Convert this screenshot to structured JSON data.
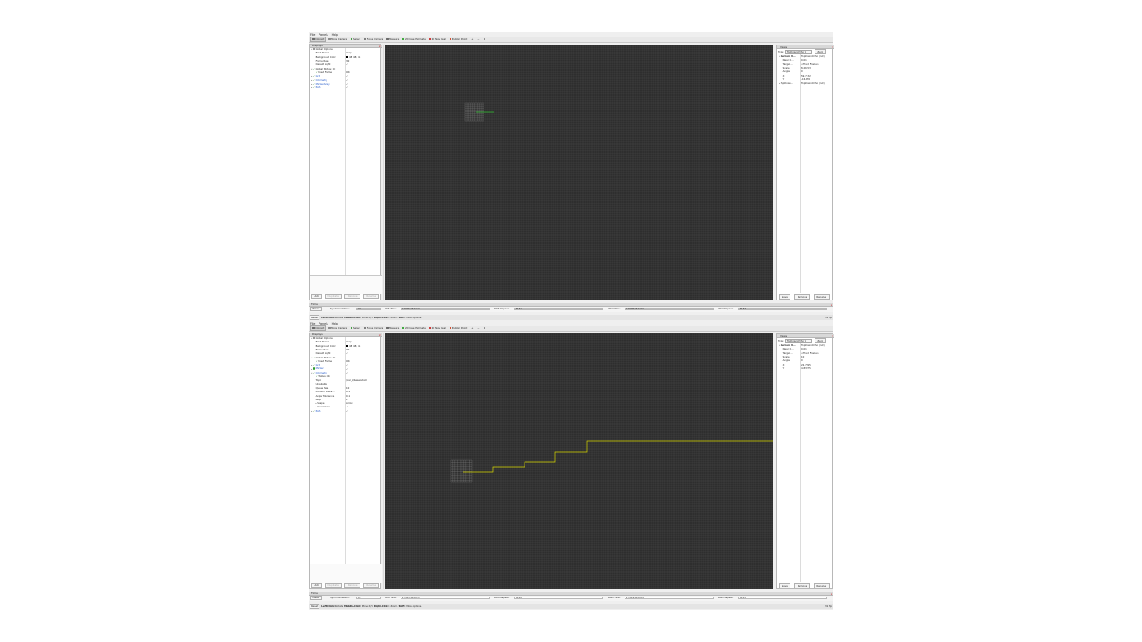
{
  "menu": [
    "File",
    "Panels",
    "Help"
  ],
  "toolbar": [
    {
      "label": "Interact",
      "icon": "interact-icon",
      "color": "#6a6a6a"
    },
    {
      "label": "Move Camera",
      "icon": "camera-icon",
      "color": "#8a8a8a"
    },
    {
      "label": "Select",
      "icon": "select-icon",
      "color": "#3f9b3f"
    },
    {
      "label": "Focus Camera",
      "icon": "focus-icon",
      "color": "#7a7a7a"
    },
    {
      "label": "Measure",
      "icon": "measure-icon",
      "color": "#6a6a6a"
    },
    {
      "label": "2D Pose Estimate",
      "icon": "pose-estimate-icon",
      "color": "#3aa83a"
    },
    {
      "label": "2D Nav Goal",
      "icon": "nav-goal-icon",
      "color": "#cc3333"
    },
    {
      "label": "Publish Point",
      "icon": "publish-point-icon",
      "color": "#d14a2a"
    }
  ],
  "toolbar_extras": [
    "+",
    "−",
    "↕"
  ],
  "displays_title": "Displays",
  "views_title": "Views",
  "time_title": "Time",
  "display_buttons": [
    "Add",
    "Duplicate",
    "Remove",
    "Rename"
  ],
  "view_type_label": "Type:",
  "view_type_value": "TopDownOrtho",
  "view_zero": "Zero",
  "view_buttons": [
    "Save",
    "Remove",
    "Rename"
  ],
  "time_labels": {
    "pause": "Pause",
    "sync": "Synchronization:",
    "ros_time": "ROS Time:",
    "ros_elapsed": "ROS Elapsed:",
    "wall_time": "Wall Time:",
    "wall_elapsed": "Wall Elapsed:"
  },
  "status": {
    "reset": "Reset",
    "hint_1": "Left-Click:",
    "hint_2": " Rotate. ",
    "hint_3": "Middle-Click:",
    "hint_4": " Move X/Y. ",
    "hint_5": "Right-Click:",
    "hint_6": ": Zoom. ",
    "hint_7": "Shift",
    "hint_8": ": More options."
  },
  "windows": [
    {
      "displays": [
        {
          "key": "Global Options",
          "value": "",
          "indent": 1,
          "expander": "▾",
          "icon": "gear-icon",
          "check": ""
        },
        {
          "key": "Fixed Frame",
          "value": "map",
          "indent": 3
        },
        {
          "key": "Background Color",
          "value": "48; 48; 48",
          "indent": 3,
          "swatch": true
        },
        {
          "key": "Frame Rate",
          "value": "30",
          "indent": 3
        },
        {
          "key": "Default Light",
          "value": "✓",
          "indent": 3
        },
        {
          "key": "Global Status: Ok",
          "value": "",
          "indent": 1,
          "expander": "▾",
          "check": "✓"
        },
        {
          "key": "Fixed Frame",
          "value": "OK",
          "indent": 3,
          "check": "✓"
        },
        {
          "key": "Grid",
          "value": "✓",
          "indent": 1,
          "expander": "▸",
          "check": "✓",
          "blue": true
        },
        {
          "key": "Odometry",
          "value": "✓",
          "indent": 1,
          "expander": "▸",
          "check": "✓",
          "blue": true
        },
        {
          "key": "MarkerArray",
          "value": "✓",
          "indent": 1,
          "expander": "▸",
          "check": "✓",
          "blue": true
        },
        {
          "key": "Path",
          "value": "✓",
          "indent": 1,
          "expander": "▸",
          "check": "✓",
          "blue": true
        }
      ],
      "views": [
        {
          "key": "Current V...",
          "value": "TopDownOrtho (rviz)",
          "indent": 1,
          "expander": "▾",
          "bold": true
        },
        {
          "key": "Near Cl...",
          "value": "0.01",
          "indent": 3
        },
        {
          "key": "Target ...",
          "value": "<Fixed Frame>",
          "indent": 3
        },
        {
          "key": "Scale",
          "value": "8.26153",
          "indent": 3
        },
        {
          "key": "Angle",
          "value": "0",
          "indent": 3
        },
        {
          "key": "X",
          "value": "59.7132",
          "indent": 3
        },
        {
          "key": "Y",
          "value": "-16.176",
          "indent": 3
        },
        {
          "key": "TopDown...",
          "value": "TopDownOrtho (rviz)",
          "indent": 1,
          "expander": "▸"
        }
      ],
      "time": {
        "sync": "Off",
        "ros_time": "1730591542.90",
        "ros_elapsed": "38.61",
        "wall_time": "1730591542.93",
        "wall_elapsed": "38.53"
      },
      "fps": "31 fps"
    },
    {
      "displays": [
        {
          "key": "Global Options",
          "value": "",
          "indent": 1,
          "expander": "▾",
          "icon": "gear-icon",
          "check": ""
        },
        {
          "key": "Fixed Frame",
          "value": "map",
          "indent": 3
        },
        {
          "key": "Background Color",
          "value": "48; 48; 48",
          "indent": 3,
          "swatch": true
        },
        {
          "key": "Frame Rate",
          "value": "30",
          "indent": 3
        },
        {
          "key": "Default Light",
          "value": "✓",
          "indent": 3
        },
        {
          "key": "Global Status: Ok",
          "value": "",
          "indent": 1,
          "expander": "▾",
          "check": "✓"
        },
        {
          "key": "Fixed Frame",
          "value": "OK",
          "indent": 3,
          "check": "✓"
        },
        {
          "key": "Grid",
          "value": "✓",
          "indent": 1,
          "expander": "▸",
          "check": "✓",
          "blue": true
        },
        {
          "key": "Marker",
          "value": "✓",
          "indent": 1,
          "expander": "▸",
          "icon": "marker-icon",
          "blue": true
        },
        {
          "key": "Odometry",
          "value": "✓",
          "indent": 1,
          "expander": "▾",
          "check": "✓",
          "blue": true
        },
        {
          "key": "Status: Ok",
          "value": "",
          "indent": 3,
          "check": "✓"
        },
        {
          "key": "Topic",
          "value": "/car_1/base/odom",
          "indent": 3
        },
        {
          "key": "Unreliable",
          "value": "",
          "indent": 3
        },
        {
          "key": "Queue Size",
          "value": "10",
          "indent": 3
        },
        {
          "key": "Position Tolera...",
          "value": "0.1",
          "indent": 3
        },
        {
          "key": "Angle Tolerance",
          "value": "0.1",
          "indent": 3
        },
        {
          "key": "Keep",
          "value": "1",
          "indent": 3
        },
        {
          "key": "Shape",
          "value": "Arrow",
          "indent": 3,
          "expander": "▸"
        },
        {
          "key": "Covariance",
          "value": "✓",
          "indent": 3,
          "expander": "▸"
        },
        {
          "key": "Path",
          "value": "✓",
          "indent": 1,
          "expander": "▸",
          "check": "✓",
          "blue": true
        }
      ],
      "views": [
        {
          "key": "Current V...",
          "value": "TopDownOrtho (rviz)",
          "indent": 1,
          "expander": "▾",
          "bold": true
        },
        {
          "key": "Near Cl...",
          "value": "0.01",
          "indent": 3
        },
        {
          "key": "Target ...",
          "value": "<Fixed Frame>",
          "indent": 3
        },
        {
          "key": "Scale",
          "value": "10",
          "indent": 3
        },
        {
          "key": "Angle",
          "value": "0",
          "indent": 3
        },
        {
          "key": "X",
          "value": "22.7995",
          "indent": 3
        },
        {
          "key": "Y",
          "value": "4.83075",
          "indent": 3
        }
      ],
      "time": {
        "sync": "Off",
        "ros_time": "1730591438.31",
        "ros_elapsed": "39.42",
        "wall_time": "1730591438.34",
        "wall_elapsed": "39.45"
      },
      "fps": "31 fps"
    }
  ],
  "colors": {
    "viewport_bg": "#303030",
    "grid": "#7a7a7a",
    "path_top": "#2fbf2f",
    "path_bottom": "#d6d600"
  }
}
